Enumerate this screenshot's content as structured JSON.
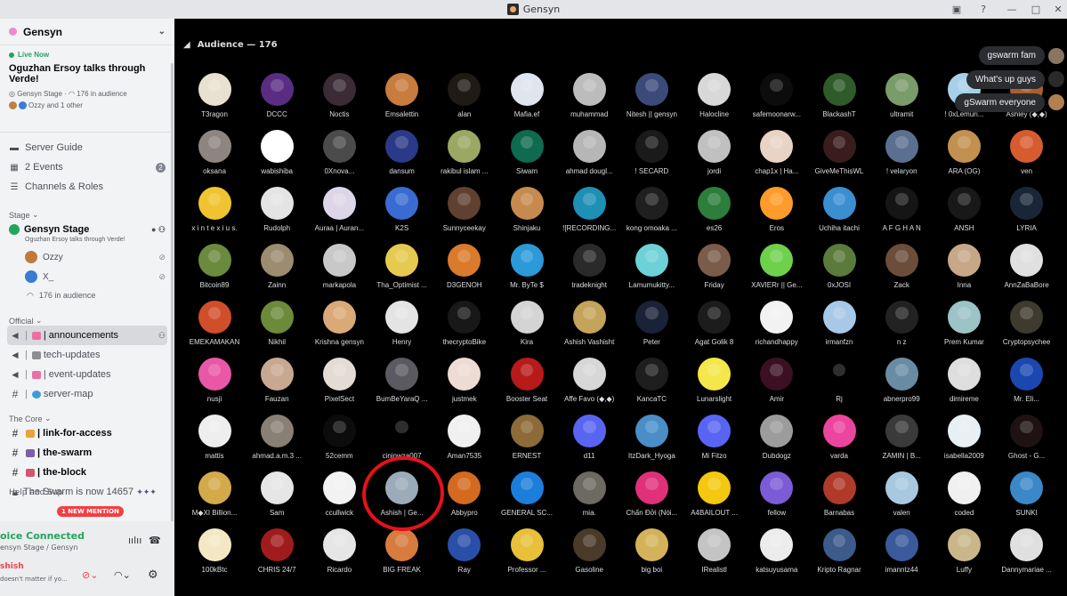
{
  "window": {
    "title": "Gensyn"
  },
  "sidebar": {
    "server_name": "Gensyn",
    "live": {
      "tag": "Live Now",
      "title": "Oguzhan Ersoy talks through Verde!",
      "stage_name": "Gensyn Stage",
      "audience": "176 in audience",
      "speakers": "Ozzy and 1 other"
    },
    "nav": [
      {
        "label": "Server Guide",
        "icon": "guide-icon"
      },
      {
        "label": "2 Events",
        "icon": "calendar-icon",
        "badge": "2"
      },
      {
        "label": "Channels & Roles",
        "icon": "list-icon"
      }
    ],
    "stage_category": "Stage",
    "stage": {
      "name": "Gensyn Stage",
      "subtitle": "Oguzhan Ersoy talks through Verde!",
      "users": [
        "Ozzy",
        "X_"
      ],
      "audience": "176 in audience"
    },
    "official_category": "Official",
    "official_channels": [
      {
        "prefix": "|",
        "suffix": "| announcements",
        "color": "#f06da3",
        "active": true
      },
      {
        "prefix": "|",
        "suffix": "tech-updates",
        "color": "#8b8d92",
        "active": false
      },
      {
        "prefix": "|",
        "suffix": "| event-updates",
        "color": "#f06da3",
        "active": false
      },
      {
        "prefix": "|",
        "suffix": "server-map",
        "color": "#3d9bd8",
        "active": false
      }
    ],
    "core_category": "The Core",
    "core_channels": [
      {
        "label": "| link-for-access",
        "color": "#e8a33a"
      },
      {
        "label": "| the-swarm",
        "color": "#7b5ea7"
      },
      {
        "label": "| the-block",
        "color": "#d6536f"
      }
    ],
    "swarm_text": "The Swarm is now 14657",
    "help": "Help and Sup",
    "mention": "1 NEW MENTION",
    "voice": {
      "status": "oice Connected",
      "where": "ensyn Stage / Gensyn",
      "user": "shish",
      "user_status": "doesn't matter if yo..."
    }
  },
  "main": {
    "audience_header": "Audience — 176",
    "bubbles": [
      "gswarm fam",
      "What's up guys",
      "gSwarm everyone"
    ],
    "rows": [
      [
        "T3ragon",
        "DCCC",
        "Noctis",
        "Emsalettin",
        "alan",
        "Mafia.ef",
        "muhammad",
        "Nitesh || gensyn",
        "Halocline",
        "safemoonarw...",
        "BlackashT",
        "ultramit",
        "! 0xLemuri...",
        "Ashley (◆,◆)"
      ],
      [
        "oksana",
        "wabishiba",
        "0Xnova...",
        "dansum",
        "rakibul islam ...",
        "Siwam",
        "ahmad dougl...",
        "! SECARD",
        "jordi",
        "chap1x | Ha...",
        "GiveMeThisWL",
        "! velaryon",
        "ARA (OG)",
        "ven"
      ],
      [
        "x i n t e x i u s.",
        "Rudolph",
        "Auraa | Auran...",
        "K2S",
        "Sunnyceekay",
        "Shinjaku",
        "![RECORDING...",
        "kong omoaka ...",
        "es26",
        "Eros",
        "Uchiha itachi",
        "A F G H A N",
        "ANSH",
        "LYRIA"
      ],
      [
        "Bitcoin89",
        "Zainn",
        "markapola",
        "Tha_Optimist ...",
        "D3GENOH",
        "Mr. ByTe $",
        "tradeknight",
        "Lamumukitty...",
        "Friday",
        "XAVIERr || Ge...",
        "0xJOSI",
        "Zack",
        "Inna",
        "AnnZaBaBore"
      ],
      [
        "EMEKAMAKAN",
        "Nikhil",
        "Krishna gensyn",
        "Henry",
        "thecryptoBike",
        "Kira",
        "Ashish Vashisht",
        "Peter",
        "Agat Golik 8",
        "richandhappy",
        "irmanfzn",
        "n z",
        "Prem Kumar",
        "Cryptopsychee"
      ],
      [
        "nusji",
        "Fauzan",
        "PixelSect",
        "BumBeYaraQ ...",
        "justmek",
        "Booster Seat",
        "Affe Favo (◆,◆)",
        "KancaTC",
        "Lunarslight",
        "Amir",
        "Rj",
        "abnerpro99",
        "dimireme",
        "Mr. Eli..."
      ],
      [
        "mattis",
        "ahmad.a.m.3 ...",
        "52cemm",
        "cininwza007",
        "Aman7535",
        "ERNEST",
        "d11",
        "ItzDark_Hyoga",
        "Mi Fitzo",
        "Dubdogz",
        "varda",
        "ZAMIN | B...",
        "isabella2009",
        "Ghost - G..."
      ],
      [
        "M◆XI Billion...",
        "Sam",
        "ccullwick",
        "Ashish | Ge...",
        "Abbypro",
        "GENERAL SC...",
        "mia.",
        "Chấn Đởi (Nói...",
        "A4BAILOUT ...",
        "fellow",
        "Barnabas",
        "valen",
        "coded",
        "SUNKI"
      ],
      [
        "100kBtc",
        "CHRIS 24/7",
        "Ricardo",
        "BIG FREAK",
        "Ray",
        "Professor ...",
        "Gasoline",
        "big boi",
        "IRealistl",
        "katsuyusama",
        "Kripto Ragnar",
        "imanntz44",
        "Luffy",
        "Dannymariae ..."
      ]
    ],
    "colors": [
      [
        "#e8e0d0",
        "#5a2d82",
        "#3a2b35",
        "#c87c3e",
        "#201a14",
        "#dfe5ee",
        "#bcbcbc",
        "#3c4a7a",
        "#d8d8d8",
        "#0c0c0c",
        "#2f5b2a",
        "#7a9b6a",
        "#a7d0e8",
        "#aa5f2f"
      ],
      [
        "#8d8680",
        "#ffffff",
        "#4b4b4b",
        "#2a3a88",
        "#9aa864",
        "#0e6b4f",
        "#b6b6b6",
        "#1a1a1a",
        "#c0c0c0",
        "#e8d3c5",
        "#3a1c1c",
        "#5b6f91",
        "#c29150",
        "#d65c30"
      ],
      [
        "#f0c431",
        "#e4e4e4",
        "#ddd6e8",
        "#3a6bd2",
        "#604030",
        "#c78a4e",
        "#1e8fb5",
        "#1f1f1f",
        "#2d7d3b",
        "#ff9b2a",
        "#3a8fd0",
        "#151515",
        "#181818",
        "#1a2638"
      ],
      [
        "#6a8a3e",
        "#9c8c70",
        "#c8c8c8",
        "#e6c94f",
        "#d97b2b",
        "#2b9ad8",
        "#2a2a2a",
        "#6cd2d8",
        "#7b5c4a",
        "#6fd04c",
        "#5a7b3a",
        "#6b4d3a",
        "#c6a888",
        "#e0e0e0"
      ],
      [
        "#d04e2a",
        "#6c8a3a",
        "#d9aa77",
        "#e4e4e4",
        "#181818",
        "#d4d4d4",
        "#c4a45a",
        "#1a2238",
        "#1c1c1c",
        "#f2f2f2",
        "#a8c8e8",
        "#222222",
        "#9cc3c6",
        "#3f3a2e"
      ],
      [
        "#e957a7",
        "#c9a892",
        "#e2dcd5",
        "#5a5a60",
        "#eddcd4",
        "#b81a1a",
        "#d7d7d7",
        "#1e1e1e",
        "#f5e64a",
        "#3a1022",
        "#000000",
        "#6a8ba4",
        "#dedede",
        "#1a48b0"
      ],
      [
        "#eeeeee",
        "#8a7f74",
        "#0c0c0c",
        "#000000",
        "#f0f0f0",
        "#8c6b38",
        "#5865f2",
        "#4a8ec8",
        "#5865f2",
        "#9c9c9c",
        "#eb459e",
        "#3a3a3a",
        "#e6f0f5",
        "#1f1212"
      ],
      [
        "#d4a94a",
        "#e6e6e6",
        "#f2f2f2",
        "#9cabba",
        "#d46a20",
        "#1b7edb",
        "#6d6a62",
        "#e0307a",
        "#f4c810",
        "#7b5bd6",
        "#b03a2a",
        "#a8c8e0",
        "#f0f0f0",
        "#3a88c8"
      ],
      [
        "#f4e8c4",
        "#a01c1c",
        "#e6e6e6",
        "#d77b3f",
        "#2a4fa8",
        "#e8c03a",
        "#4a3a2a",
        "#d3b25a",
        "#c4c4c4",
        "#ececec",
        "#3c5a8a",
        "#3a5a9c",
        "#c9b78a",
        "#e0e0e0"
      ]
    ]
  }
}
